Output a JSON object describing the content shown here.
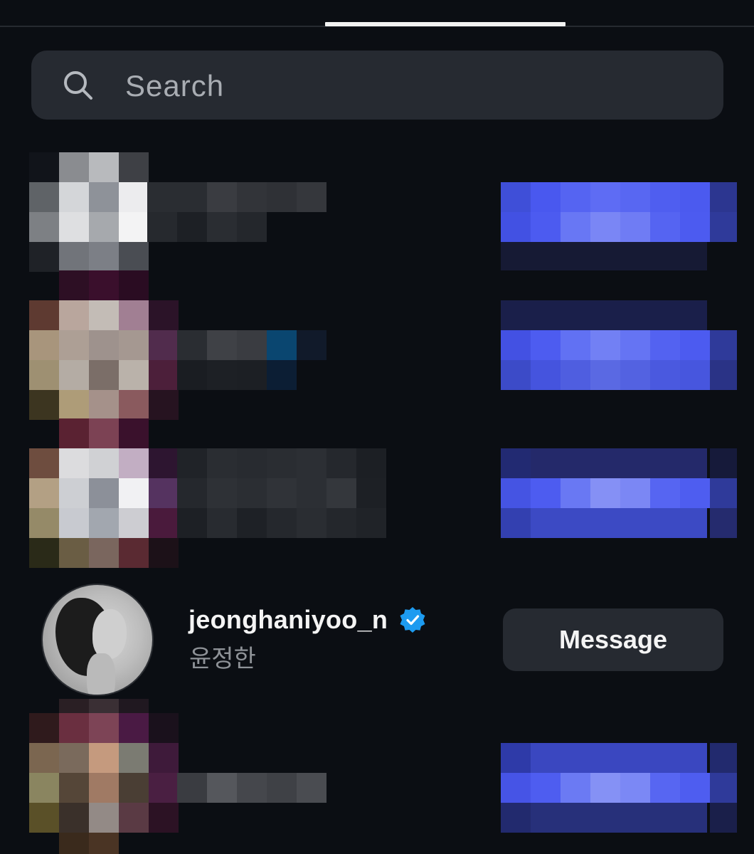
{
  "search": {
    "placeholder": "Search"
  },
  "profile": {
    "username": "jeonghaniyoo_n",
    "full_name": "윤정한",
    "verified": true,
    "button_label": "Message"
  },
  "colors": {
    "background": "#0b0e13",
    "search_bg": "#262a31",
    "button_bg": "#262a31",
    "verified_badge": "#1d9bf0",
    "blurred_button": "#4957ee"
  },
  "icons": [
    "search-icon",
    "verified-badge-icon"
  ]
}
